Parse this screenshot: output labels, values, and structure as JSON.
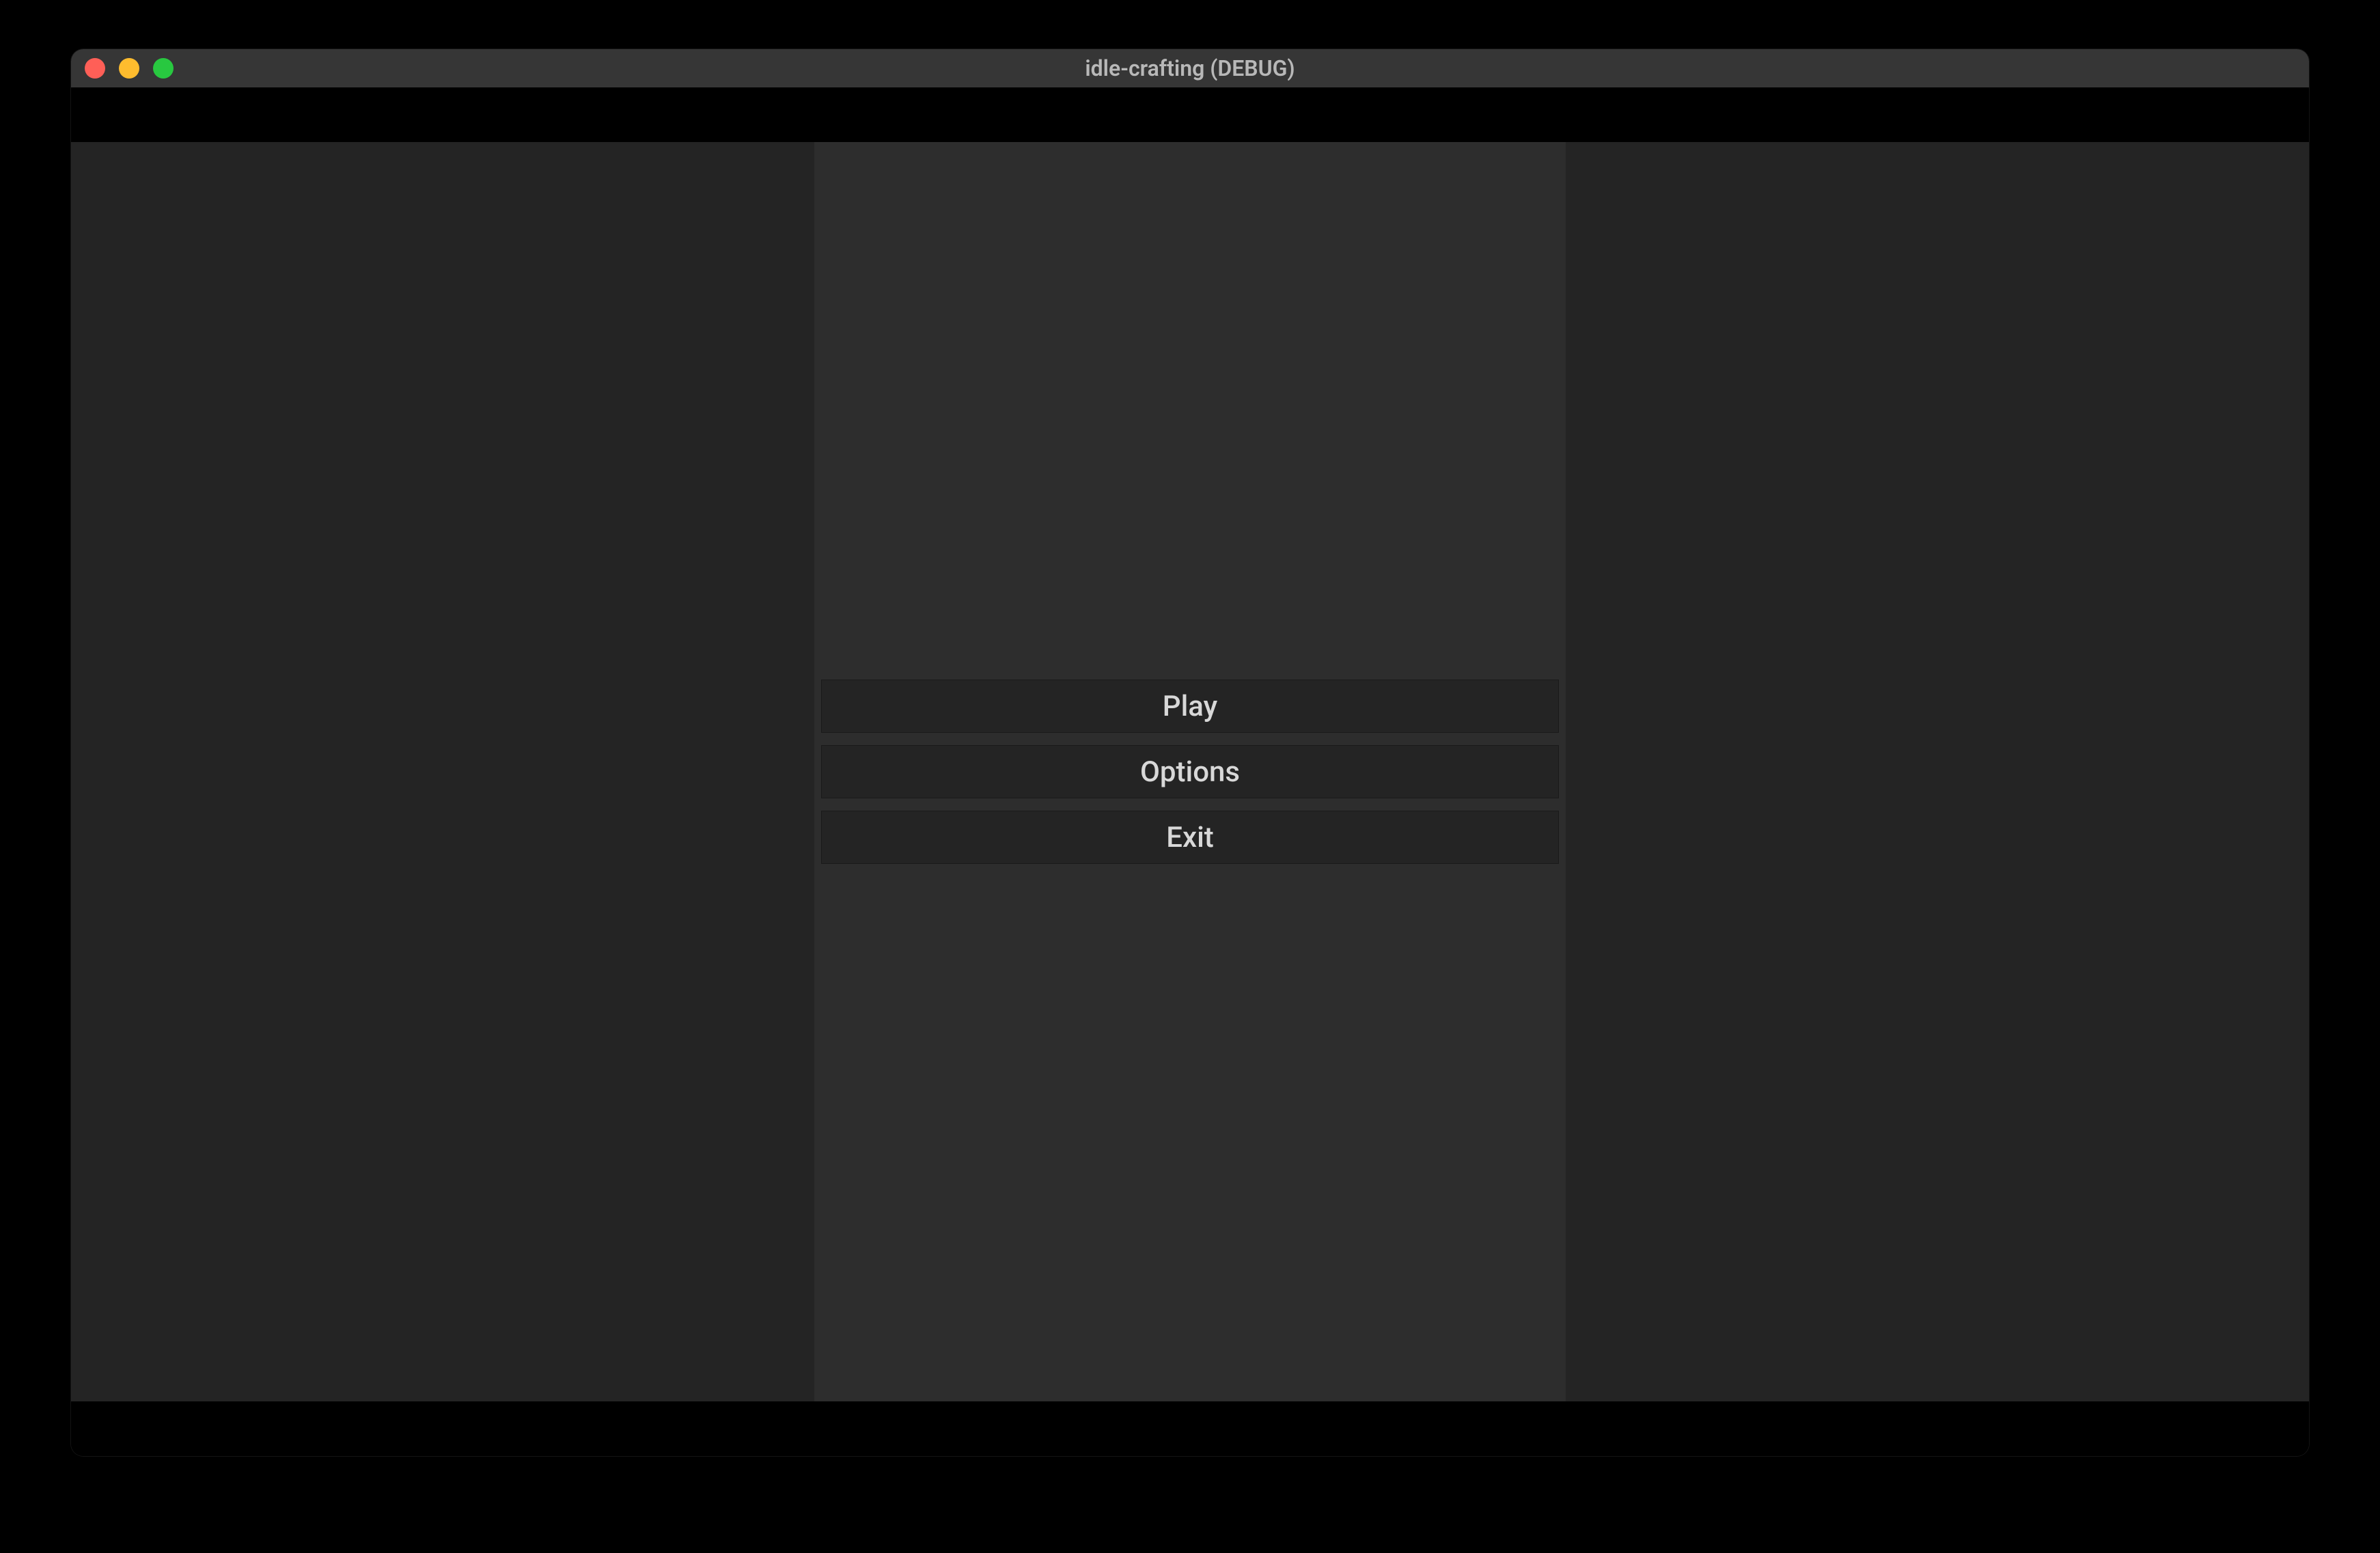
{
  "window": {
    "title": "idle-crafting (DEBUG)"
  },
  "menu": {
    "play_label": "Play",
    "options_label": "Options",
    "exit_label": "Exit"
  }
}
